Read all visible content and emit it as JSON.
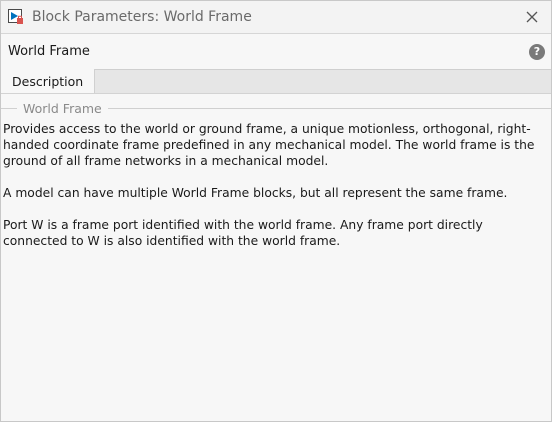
{
  "window": {
    "title": "Block Parameters: World Frame"
  },
  "header": {
    "block_name": "World Frame",
    "help_glyph": "?"
  },
  "tabs": [
    {
      "label": "Description"
    }
  ],
  "group": {
    "title": "World Frame"
  },
  "description": {
    "paragraphs": [
      "Provides access to the world or ground frame, a unique motionless, orthogonal, right-handed coordinate frame predefined in any mechanical model. The world frame is the ground of all frame networks in a mechanical model.",
      "A model can have multiple World Frame blocks, but all represent the same frame.",
      "Port W is a frame port identified with the world frame. Any frame port directly connected to W is also identified with the world frame."
    ]
  },
  "icons": {
    "app": "simulink-block-icon",
    "close": "close-icon",
    "help": "help-icon"
  },
  "colors": {
    "accent": "#0072bd",
    "lock": "#d9534f"
  }
}
